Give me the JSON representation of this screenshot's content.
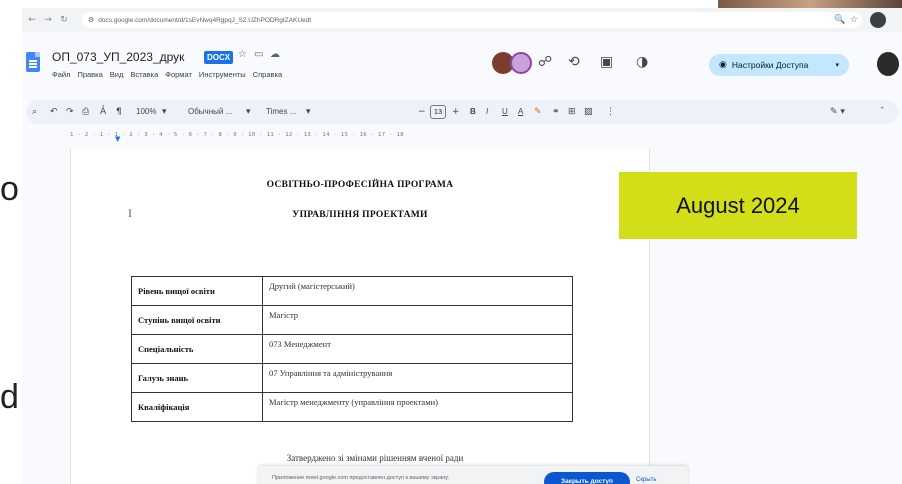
{
  "browser": {
    "url": "docs.google.com/document/d/1sEvNwq4RgpqJ_S2.UZhPODRgtZAKUedt"
  },
  "doc": {
    "title": "ОП_073_УП_2023_друк",
    "badge": "DOCX",
    "menu": [
      "Файл",
      "Правка",
      "Вид",
      "Вставка",
      "Формат",
      "Инструменты",
      "Справка"
    ],
    "share_label": "Настройки Доступа"
  },
  "toolbar": {
    "zoom": "100%",
    "style": "Обычный ...",
    "font": "Times ...",
    "font_size": "13",
    "buttons": [
      "B",
      "I",
      "U",
      "A"
    ]
  },
  "ruler_text": "1 · 2 · 1 · 1 · 2 · 3 · 4 · 5 · 6 · 7 · 8 · 9 · 10 · 11 · 12 · 13 · 14 · 15 · 16 · 17 · 18",
  "page": {
    "heading1": "ОСВІТНЬО-ПРОФЕСІЙНА ПРОГРАМА",
    "heading2": "УПРАВЛІННЯ ПРОЕКТАМИ",
    "table": [
      {
        "key": "Рівень вищої освіти",
        "value": "Другий (магістерський)"
      },
      {
        "key": "Ступінь вищої освіти",
        "value": "Магістр"
      },
      {
        "key": "Спеціальність",
        "value": "073 Менеджмент"
      },
      {
        "key": "Галузь знань",
        "value": "07 Управління та адміністрування"
      },
      {
        "key": "Кваліфікація",
        "value": "Магістр менеджменту (управління проектами)"
      }
    ],
    "footer": "Затверджено зі змінами рішенням вченої ради"
  },
  "notification": {
    "text": "Приложение meet.google.com предоставлен доступ к вашему экрану.",
    "primary": "Закрыть доступ",
    "secondary": "Скрыть"
  },
  "overlay": {
    "date": "August 2024"
  },
  "slide": {
    "char_top": "o",
    "char_bottom": "d"
  },
  "colors": {
    "share_button": "#c2e7ff",
    "docx_badge": "#1a73e8",
    "date_label": "#d1de18",
    "notify_primary": "#0b57d0"
  }
}
